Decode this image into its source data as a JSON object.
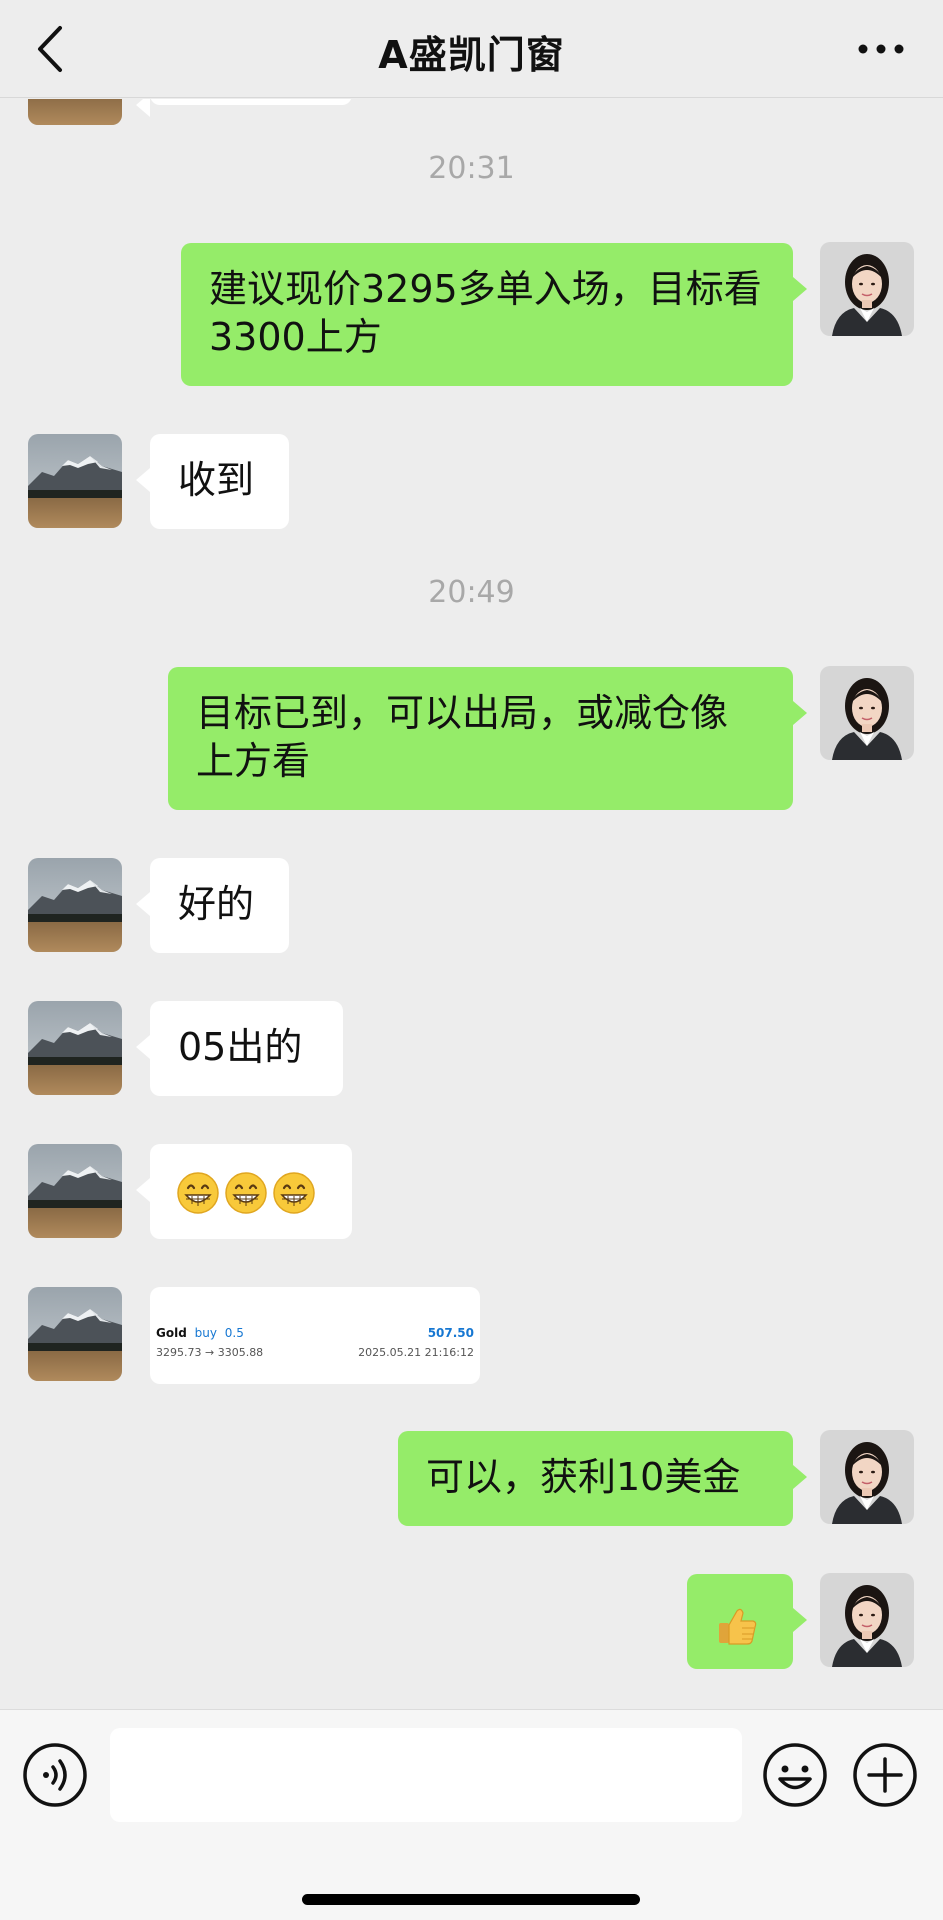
{
  "header": {
    "title": "A盛凯门窗"
  },
  "timestamps": [
    "20:31",
    "20:49"
  ],
  "messages": [
    {
      "side": "out",
      "text": "建议现价3295多单入场，目标看3300上方"
    },
    {
      "side": "in",
      "text": "收到"
    },
    {
      "side": "out",
      "text": "目标已到，可以出局，或减仓像上方看"
    },
    {
      "side": "in",
      "text": "好的"
    },
    {
      "side": "in",
      "text": "05出的"
    },
    {
      "side": "in",
      "emoji": "grinning-face-emoji",
      "count": 3
    },
    {
      "side": "in",
      "card": true
    },
    {
      "side": "out",
      "text": "可以，获利10美金"
    },
    {
      "side": "out",
      "emoji": "thumbs-up-emoji"
    }
  ],
  "trade_card": {
    "symbol": "Gold",
    "type": "buy",
    "lot": "0.5",
    "prices": "3295.73 → 3305.88",
    "profit": "507.50",
    "datetime": "2025.05.21 21:16:12"
  },
  "input": {
    "value": ""
  },
  "colors": {
    "background": "#ededed",
    "bubble_out": "#95ec69",
    "bubble_in": "#ffffff",
    "timestamp": "#a8a8a8",
    "profit_blue": "#1677d2"
  }
}
